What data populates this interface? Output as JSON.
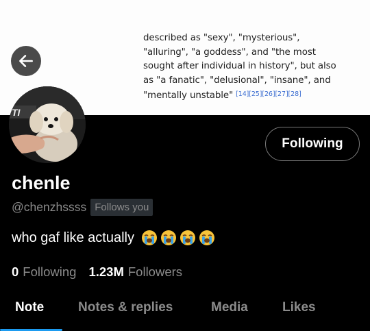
{
  "banner": {
    "lines": [
      "described as \"sexy\", \"mysterious\",",
      "\"alluring\", \"a goddess\", and \"the most",
      "sought after individual in history\", but also",
      "as  \"a fanatic\", \"delusional\", \"insane\", and",
      "\"mentally unstable\""
    ],
    "refs": "[14][25][26][27][28]"
  },
  "avatar": {
    "overlay_text": "TI"
  },
  "profile": {
    "display_name": "chenle",
    "handle": "@chenzhssss",
    "follows_you": "Follows you",
    "bio": "who gaf like actually",
    "bio_emojis": [
      "😭",
      "😭",
      "😭",
      "😭"
    ],
    "following_button": "Following"
  },
  "stats": {
    "following_count": "0",
    "following_label": "Following",
    "followers_count": "1.23M",
    "followers_label": "Followers"
  },
  "tabs": [
    "Note",
    "Notes & replies",
    "Media",
    "Likes"
  ],
  "active_tab": "Note",
  "colors": {
    "accent": "#1d9bf0",
    "background": "#000000",
    "muted_text": "#8b8b8b",
    "banner_bg": "#fdfdfd",
    "citation": "#3b6dd1"
  }
}
